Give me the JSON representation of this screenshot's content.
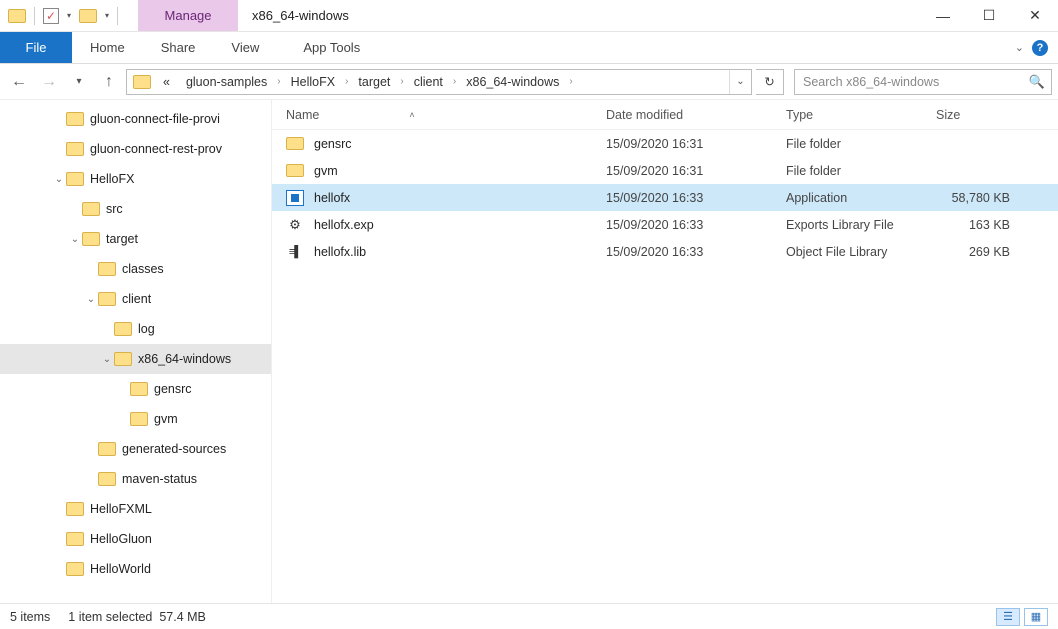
{
  "titlebar": {
    "manage_tab": "Manage",
    "window_title": "x86_64-windows"
  },
  "ribbon": {
    "file": "File",
    "home": "Home",
    "share": "Share",
    "view": "View",
    "apptools": "App Tools"
  },
  "breadcrumbs": [
    "gluon-samples",
    "HelloFX",
    "target",
    "client",
    "x86_64-windows"
  ],
  "search": {
    "placeholder": "Search x86_64-windows"
  },
  "tree": [
    {
      "label": "gluon-connect-file-provi",
      "depth": 2,
      "expandable": false,
      "selected": false
    },
    {
      "label": "gluon-connect-rest-prov",
      "depth": 2,
      "expandable": false,
      "selected": false
    },
    {
      "label": "HelloFX",
      "depth": 2,
      "expandable": true,
      "expanded": true,
      "selected": false
    },
    {
      "label": "src",
      "depth": 3,
      "expandable": false,
      "selected": false
    },
    {
      "label": "target",
      "depth": 3,
      "expandable": true,
      "expanded": true,
      "selected": false
    },
    {
      "label": "classes",
      "depth": 4,
      "expandable": false,
      "selected": false
    },
    {
      "label": "client",
      "depth": 4,
      "expandable": true,
      "expanded": true,
      "selected": false
    },
    {
      "label": "log",
      "depth": 5,
      "expandable": false,
      "selected": false
    },
    {
      "label": "x86_64-windows",
      "depth": 5,
      "expandable": true,
      "expanded": true,
      "selected": true
    },
    {
      "label": "gensrc",
      "depth": 6,
      "expandable": false,
      "selected": false
    },
    {
      "label": "gvm",
      "depth": 6,
      "expandable": false,
      "selected": false
    },
    {
      "label": "generated-sources",
      "depth": 4,
      "expandable": false,
      "selected": false
    },
    {
      "label": "maven-status",
      "depth": 4,
      "expandable": false,
      "selected": false
    },
    {
      "label": "HelloFXML",
      "depth": 2,
      "expandable": false,
      "selected": false
    },
    {
      "label": "HelloGluon",
      "depth": 2,
      "expandable": false,
      "selected": false
    },
    {
      "label": "HelloWorld",
      "depth": 2,
      "expandable": false,
      "selected": false
    }
  ],
  "columns": {
    "name": "Name",
    "date": "Date modified",
    "type": "Type",
    "size": "Size"
  },
  "files": [
    {
      "icon": "folder",
      "name": "gensrc",
      "date": "15/09/2020 16:31",
      "type": "File folder",
      "size": "",
      "selected": false
    },
    {
      "icon": "folder",
      "name": "gvm",
      "date": "15/09/2020 16:31",
      "type": "File folder",
      "size": "",
      "selected": false
    },
    {
      "icon": "app",
      "name": "hellofx",
      "date": "15/09/2020 16:33",
      "type": "Application",
      "size": "58,780 KB",
      "selected": true
    },
    {
      "icon": "gear",
      "name": "hellofx.exp",
      "date": "15/09/2020 16:33",
      "type": "Exports Library File",
      "size": "163 KB",
      "selected": false
    },
    {
      "icon": "lib",
      "name": "hellofx.lib",
      "date": "15/09/2020 16:33",
      "type": "Object File Library",
      "size": "269 KB",
      "selected": false
    }
  ],
  "status": {
    "count": "5 items",
    "selection": "1 item selected",
    "size": "57.4 MB"
  }
}
